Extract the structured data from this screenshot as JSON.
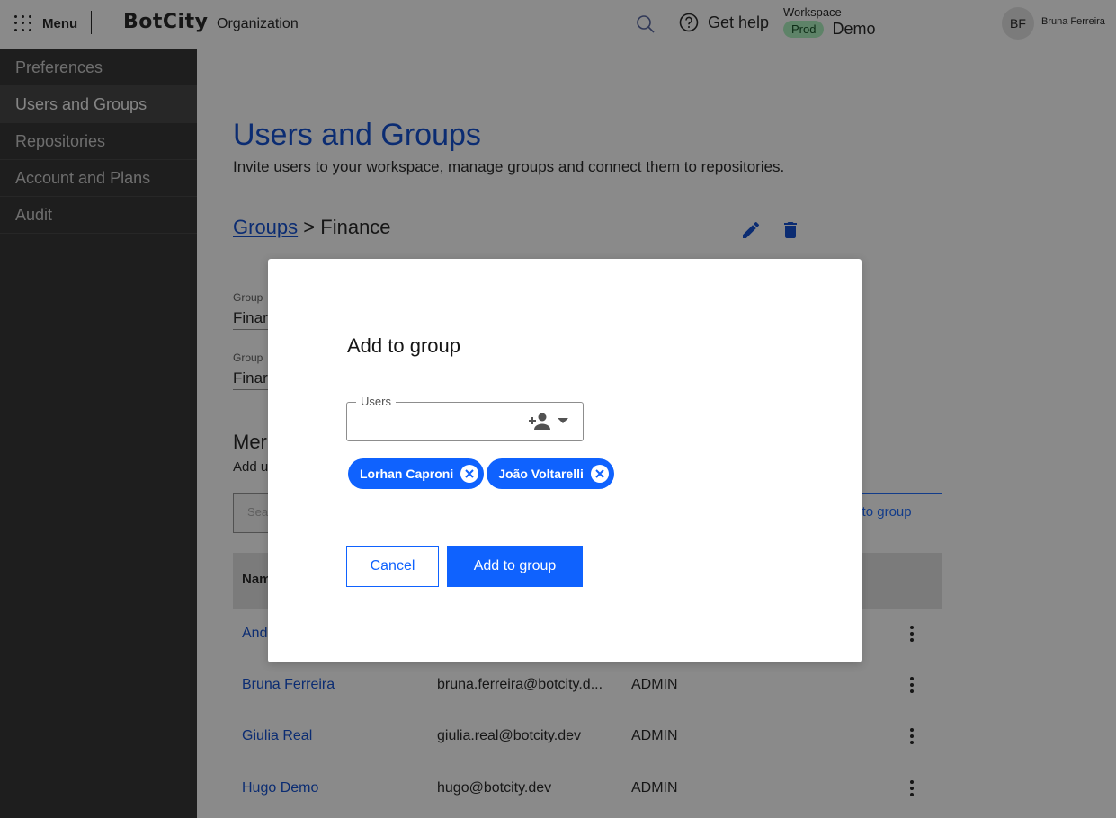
{
  "topbar": {
    "menu_label": "Menu",
    "logo": "BotCity",
    "org_label": "Organization",
    "help_label": "Get help",
    "workspace": {
      "label": "Workspace",
      "badge": "Prod",
      "value": "Demo"
    },
    "user": {
      "initials": "BF",
      "name": "Bruna Ferreira"
    }
  },
  "sidebar": {
    "items": [
      {
        "label": "Preferences"
      },
      {
        "label": "Users and Groups"
      },
      {
        "label": "Repositories"
      },
      {
        "label": "Account and Plans"
      },
      {
        "label": "Audit"
      }
    ]
  },
  "main": {
    "title": "Users and Groups",
    "subtitle": "Invite users to your workspace, manage groups and connect them to repositories.",
    "breadcrumb": {
      "link": "Groups",
      "separator": ">",
      "current": "Finance"
    },
    "fields": [
      {
        "label": "Group",
        "value": "Finar"
      },
      {
        "label": "Group",
        "value": "Finar"
      }
    ],
    "members": {
      "title": "Mer",
      "subtitle": "Add u",
      "search_placeholder": "Sea",
      "add_button": "r to group",
      "header_col1": "Nam",
      "rows": [
        {
          "name": "And",
          "email": "",
          "role": ""
        },
        {
          "name": "Bruna Ferreira",
          "email": "bruna.ferreira@botcity.d...",
          "role": "ADMIN"
        },
        {
          "name": "Giulia Real",
          "email": "giulia.real@botcity.dev",
          "role": "ADMIN"
        },
        {
          "name": "Hugo Demo",
          "email": "hugo@botcity.dev",
          "role": "ADMIN"
        }
      ]
    }
  },
  "modal": {
    "title": "Add to group",
    "users_label": "Users",
    "chips": [
      {
        "label": "Lorhan Caproni"
      },
      {
        "label": "João Voltarelli"
      }
    ],
    "cancel_label": "Cancel",
    "confirm_label": "Add to group"
  },
  "colors": {
    "primary": "#0f62fe",
    "link": "#0043ce",
    "sidebar_bg": "#262626",
    "badge_bg": "#a7f0ba"
  }
}
